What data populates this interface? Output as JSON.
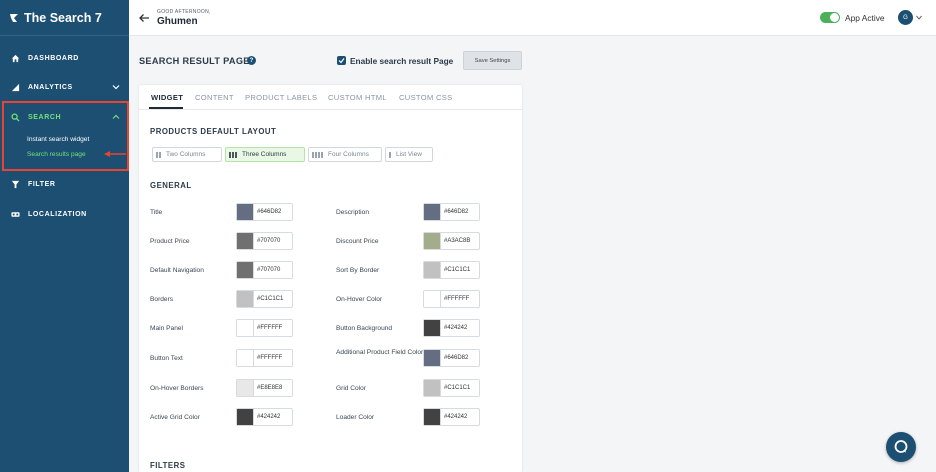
{
  "sidebar": {
    "brand": "The Search 7",
    "items": [
      {
        "label": "DASHBOARD"
      },
      {
        "label": "ANALYTICS"
      },
      {
        "label": "SEARCH"
      },
      {
        "label": "FILTER"
      },
      {
        "label": "LOCALIZATION"
      }
    ],
    "search_sub": [
      {
        "label": "Instant search widget"
      },
      {
        "label": "Search results page"
      }
    ],
    "colors": {
      "bg": "#1d4f73",
      "active": "#6ee37a",
      "highlight": "#e8442f"
    }
  },
  "topbar": {
    "greeting": "GOOD AFTERNOON,",
    "shop": "Ghumen",
    "app_status": "App Active",
    "avatar": "G"
  },
  "page": {
    "title": "SEARCH RESULT PAGE",
    "enable_label": "Enable search result Page",
    "save_label": "Save Settings",
    "tabs": [
      {
        "label": "WIDGET"
      },
      {
        "label": "CONTENT"
      },
      {
        "label": "PRODUCT LABELS"
      },
      {
        "label": "CUSTOM HTML"
      },
      {
        "label": "CUSTOM CSS"
      }
    ],
    "layout_heading": "PRODUCTS DEFAULT LAYOUT",
    "layouts": [
      {
        "label": "Two Columns"
      },
      {
        "label": "Three Columns"
      },
      {
        "label": "Four Columns"
      },
      {
        "label": "List View"
      }
    ],
    "general_heading": "GENERAL",
    "filters_heading": "FILTERS",
    "colors_left": [
      {
        "label": "Title",
        "hex": "#646D82"
      },
      {
        "label": "Product Price",
        "hex": "#707070"
      },
      {
        "label": "Default Navigation",
        "hex": "#707070"
      },
      {
        "label": "Borders",
        "hex": "#C1C1C1"
      },
      {
        "label": "Main Panel",
        "hex": "#FFFFFF"
      },
      {
        "label": "Button Text",
        "hex": "#FFFFFF"
      },
      {
        "label": "On-Hover Borders",
        "hex": "#E8E8E8"
      },
      {
        "label": "Active Grid Color",
        "hex": "#424242"
      }
    ],
    "colors_right": [
      {
        "label": "Description",
        "hex": "#646D82"
      },
      {
        "label": "Discount Price",
        "hex": "#A3AC8B"
      },
      {
        "label": "Sort By Border",
        "hex": "#C1C1C1"
      },
      {
        "label": "On-Hover Color",
        "hex": "#FFFFFF"
      },
      {
        "label": "Button Background",
        "hex": "#424242"
      },
      {
        "label": "Additional Product Field Color",
        "hex": "#646D82"
      },
      {
        "label": "Grid Color",
        "hex": "#C1C1C1"
      },
      {
        "label": "Loader Color",
        "hex": "#424242"
      }
    ]
  }
}
